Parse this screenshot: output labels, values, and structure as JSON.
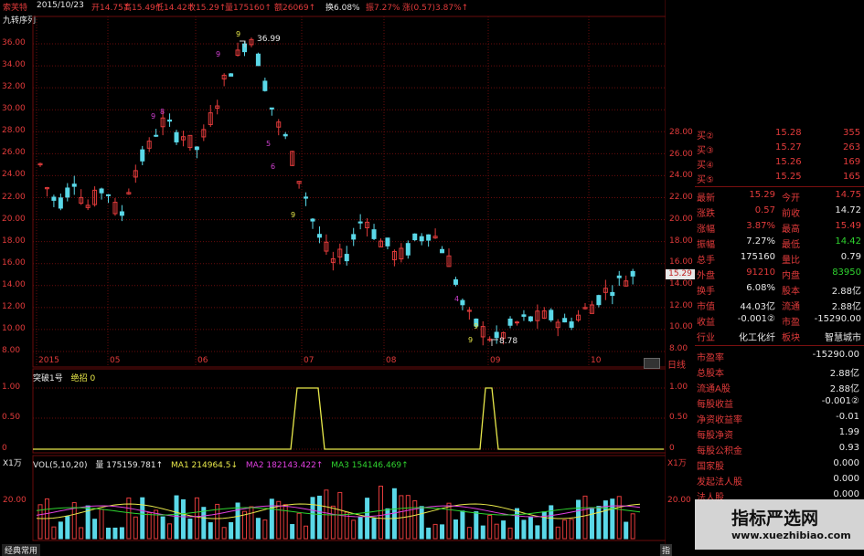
{
  "header": {
    "stock_name": "索芙特",
    "date": "2015/10/23",
    "open": "开14.75↑",
    "high": "高15.49↑",
    "low": "低14.42↑",
    "close": "收15.29↑",
    "volume": "量175160↑",
    "amount": "额26069↑",
    "turnover": "换6.08%",
    "amplitude": "振7.27%",
    "change": "涨(0.57)3.87%↑"
  },
  "indicator_label": "九转序列",
  "main_chart": {
    "y_ticks": [
      "36.00",
      "34.00",
      "32.00",
      "30.00",
      "28.00",
      "26.00",
      "24.00",
      "22.00",
      "20.00",
      "18.00",
      "16.00",
      "14.00",
      "12.00",
      "10.00",
      "8.00"
    ],
    "right_ticks": [
      "28.00",
      "26.00",
      "24.00",
      "22.00",
      "20.00",
      "18.00",
      "16.00",
      "14.00",
      "12.00",
      "10.00",
      "8.00"
    ],
    "x_ticks": [
      "2015",
      "05",
      "06",
      "07",
      "08",
      "09",
      "10"
    ],
    "high_label": "36.99",
    "low_label": "8.78",
    "price_tag": "15.29",
    "axis_mode": "日线"
  },
  "sub1": {
    "title": "突破1号",
    "title2": "绝招 0",
    "y_ticks": [
      "1.00",
      "0.50",
      "0"
    ],
    "right_ticks": [
      "1.00",
      "0.50",
      "0"
    ]
  },
  "sub2": {
    "unit": "X1万",
    "title": "VOL(5,10,20)",
    "vol": "量 175159.781↑",
    "ma1": "MA1 214964.5↓",
    "ma2": "MA2 182143.422↑",
    "ma3": "MA3 154146.469↑",
    "y_tick": "20.00",
    "right_unit": "X1万",
    "right_tick": "20.00"
  },
  "bottom_tab": "经典常用",
  "bottom_btn": "指",
  "quotes": [
    {
      "label": "买②",
      "price": "15.28",
      "qty": "355"
    },
    {
      "label": "买③",
      "price": "15.27",
      "qty": "263"
    },
    {
      "label": "买④",
      "price": "15.26",
      "qty": "169"
    },
    {
      "label": "买⑤",
      "price": "15.25",
      "qty": "165"
    }
  ],
  "stats": [
    {
      "l1": "最新",
      "v1": "15.29",
      "l2": "今开",
      "v2": "14.75",
      "c1": "red",
      "c2": "red"
    },
    {
      "l1": "涨跌",
      "v1": "0.57",
      "l2": "前收",
      "v2": "14.72",
      "c1": "red",
      "c2": "wht"
    },
    {
      "l1": "涨幅",
      "v1": "3.87%",
      "l2": "最高",
      "v2": "15.49",
      "c1": "red",
      "c2": "red"
    },
    {
      "l1": "振幅",
      "v1": "7.27%",
      "l2": "最低",
      "v2": "14.42",
      "c1": "wht",
      "c2": "grn"
    },
    {
      "l1": "总手",
      "v1": "175160",
      "l2": "量比",
      "v2": "0.79",
      "c1": "wht",
      "c2": "wht"
    },
    {
      "l1": "外盘",
      "v1": "91210",
      "l2": "内盘",
      "v2": "83950",
      "c1": "red",
      "c2": "grn"
    },
    {
      "l1": "换手",
      "v1": "6.08%",
      "l2": "股本",
      "v2": "2.88亿",
      "c1": "wht",
      "c2": "wht"
    },
    {
      "l1": "市值",
      "v1": "44.03亿",
      "l2": "流通",
      "v2": "2.88亿",
      "c1": "wht",
      "c2": "wht"
    },
    {
      "l1": "收益",
      "v1": "-0.001②",
      "l2": "市盈",
      "v2": "-15290.00",
      "c1": "wht",
      "c2": "wht"
    },
    {
      "l1": "行业",
      "v1": "化工化纤",
      "l2": "板块",
      "v2": "智慧城市",
      "c1": "wht",
      "c2": "wht"
    }
  ],
  "fundamentals": [
    {
      "label": "市盈率",
      "value": "-15290.00"
    },
    {
      "label": "总股本",
      "value": "2.88亿"
    },
    {
      "label": "流通A股",
      "value": "2.88亿"
    },
    {
      "label": "每股收益",
      "value": "-0.001②"
    },
    {
      "label": "净资收益率",
      "value": "-0.01"
    },
    {
      "label": "每股净资",
      "value": "1.99"
    },
    {
      "label": "每股公积金",
      "value": "0.93"
    },
    {
      "label": "国家股",
      "value": "0.000"
    },
    {
      "label": "发起法人股",
      "value": "0.000"
    },
    {
      "label": "法人股",
      "value": "0.000"
    }
  ],
  "watermark": {
    "title": "指标严选网",
    "url": "www.xuezhibiao.com"
  },
  "colors": {
    "up": "#e23b3b",
    "down": "#5ad8e8",
    "grid": "#6a0c0c",
    "yellow": "#e8e84a",
    "magenta": "#e040e0",
    "green": "#2fd32f"
  }
}
